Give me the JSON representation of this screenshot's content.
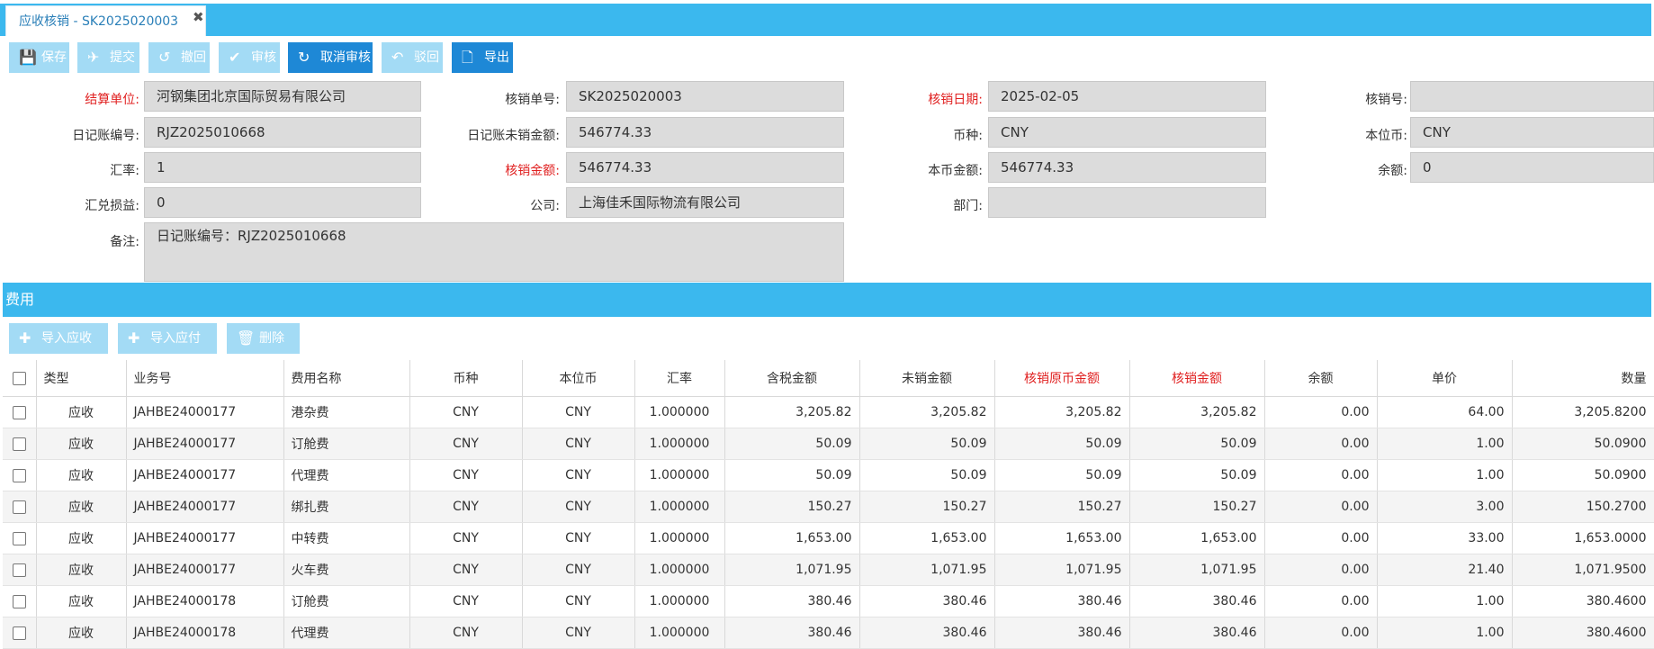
{
  "tab": {
    "title": "应收核销 - SK2025020003",
    "close": "✖"
  },
  "toolbar": [
    {
      "label": "保存",
      "icon": "💾",
      "style": "light"
    },
    {
      "label": "提交",
      "icon": "✈",
      "style": "light"
    },
    {
      "label": "撤回",
      "icon": "↺",
      "style": "light"
    },
    {
      "label": "审核",
      "icon": "✔",
      "style": "light"
    },
    {
      "label": "取消审核",
      "icon": "↻",
      "style": "dark"
    },
    {
      "label": "驳回",
      "icon": "↶",
      "style": "light"
    },
    {
      "label": "导出",
      "icon": "🗋",
      "style": "dark"
    }
  ],
  "form": {
    "settlement_unit": {
      "label": "结算单位:",
      "value": "河钢集团北京国际贸易有限公司"
    },
    "writeoff_no": {
      "label": "核销单号:",
      "value": "SK2025020003"
    },
    "writeoff_date": {
      "label": "核销日期:",
      "value": "2025-02-05"
    },
    "verify_no": {
      "label": "核销号:",
      "value": ""
    },
    "journal_no": {
      "label": "日记账编号:",
      "value": "RJZ2025010668"
    },
    "journal_unpaid": {
      "label": "日记账未销金额:",
      "value": "546774.33"
    },
    "currency": {
      "label": "币种:",
      "value": "CNY"
    },
    "base_currency": {
      "label": "本位币:",
      "value": "CNY"
    },
    "rate": {
      "label": "汇率:",
      "value": "1"
    },
    "writeoff_amount": {
      "label": "核销金额:",
      "value": "546774.33"
    },
    "base_amount": {
      "label": "本币金额:",
      "value": "546774.33"
    },
    "balance": {
      "label": "余额:",
      "value": "0"
    },
    "fx_gain": {
      "label": "汇兑损益:",
      "value": "0"
    },
    "company": {
      "label": "公司:",
      "value": "上海佳禾国际物流有限公司"
    },
    "department": {
      "label": "部门:",
      "value": ""
    },
    "remark": {
      "label": "备注:",
      "value": "日记账编号：RJZ2025010668"
    }
  },
  "section": {
    "title": "费用"
  },
  "subtoolbar": [
    {
      "label": "导入应收",
      "icon": "✚"
    },
    {
      "label": "导入应付",
      "icon": "✚"
    },
    {
      "label": "删除",
      "icon": "🗑"
    }
  ],
  "table": {
    "headers": [
      "类型",
      "业务号",
      "费用名称",
      "币种",
      "本位币",
      "汇率",
      "含税金额",
      "未销金额",
      "核销原币金额",
      "核销金额",
      "余额",
      "单价",
      "数量"
    ],
    "rows": [
      [
        "应收",
        "JAHBE24000177",
        "港杂费",
        "CNY",
        "CNY",
        "1.000000",
        "3,205.82",
        "3,205.82",
        "3,205.82",
        "3,205.82",
        "0.00",
        "64.00",
        "3,205.8200"
      ],
      [
        "应收",
        "JAHBE24000177",
        "订舱费",
        "CNY",
        "CNY",
        "1.000000",
        "50.09",
        "50.09",
        "50.09",
        "50.09",
        "0.00",
        "1.00",
        "50.0900"
      ],
      [
        "应收",
        "JAHBE24000177",
        "代理费",
        "CNY",
        "CNY",
        "1.000000",
        "50.09",
        "50.09",
        "50.09",
        "50.09",
        "0.00",
        "1.00",
        "50.0900"
      ],
      [
        "应收",
        "JAHBE24000177",
        "绑扎费",
        "CNY",
        "CNY",
        "1.000000",
        "150.27",
        "150.27",
        "150.27",
        "150.27",
        "0.00",
        "3.00",
        "150.2700"
      ],
      [
        "应收",
        "JAHBE24000177",
        "中转费",
        "CNY",
        "CNY",
        "1.000000",
        "1,653.00",
        "1,653.00",
        "1,653.00",
        "1,653.00",
        "0.00",
        "33.00",
        "1,653.0000"
      ],
      [
        "应收",
        "JAHBE24000177",
        "火车费",
        "CNY",
        "CNY",
        "1.000000",
        "1,071.95",
        "1,071.95",
        "1,071.95",
        "1,071.95",
        "0.00",
        "21.40",
        "1,071.9500"
      ],
      [
        "应收",
        "JAHBE24000178",
        "订舱费",
        "CNY",
        "CNY",
        "1.000000",
        "380.46",
        "380.46",
        "380.46",
        "380.46",
        "0.00",
        "1.00",
        "380.4600"
      ],
      [
        "应收",
        "JAHBE24000178",
        "代理费",
        "CNY",
        "CNY",
        "1.000000",
        "380.46",
        "380.46",
        "380.46",
        "380.46",
        "0.00",
        "1.00",
        "380.4600"
      ]
    ]
  }
}
